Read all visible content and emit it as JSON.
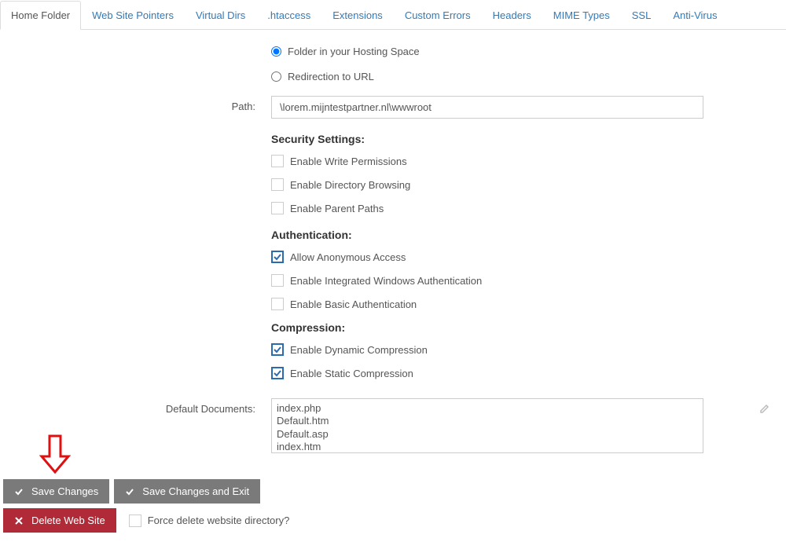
{
  "tabs": [
    {
      "label": "Home Folder",
      "active": true
    },
    {
      "label": "Web Site Pointers",
      "active": false
    },
    {
      "label": "Virtual Dirs",
      "active": false
    },
    {
      "label": ".htaccess",
      "active": false
    },
    {
      "label": "Extensions",
      "active": false
    },
    {
      "label": "Custom Errors",
      "active": false
    },
    {
      "label": "Headers",
      "active": false
    },
    {
      "label": "MIME Types",
      "active": false
    },
    {
      "label": "SSL",
      "active": false
    },
    {
      "label": "Anti-Virus",
      "active": false
    }
  ],
  "contentMode": {
    "folderOption": "Folder in your Hosting Space",
    "redirectOption": "Redirection to URL"
  },
  "pathLabel": "Path:",
  "pathValue": "\\lorem.mijntestpartner.nl\\wwwroot",
  "security": {
    "heading": "Security Settings:",
    "writePerm": "Enable Write Permissions",
    "dirBrowse": "Enable Directory Browsing",
    "parentPaths": "Enable Parent Paths"
  },
  "auth": {
    "heading": "Authentication:",
    "anon": "Allow Anonymous Access",
    "windows": "Enable Integrated Windows Authentication",
    "basic": "Enable Basic Authentication"
  },
  "compression": {
    "heading": "Compression:",
    "dynamic": "Enable Dynamic Compression",
    "static": "Enable Static Compression"
  },
  "defaultDocsLabel": "Default Documents:",
  "defaultDocs": "index.php\nDefault.htm\nDefault.asp\nindex.htm\nindex.html",
  "buttons": {
    "save": "Save Changes",
    "saveExit": "Save Changes and Exit",
    "delete": "Delete Web Site",
    "forceDelete": "Force delete website directory?"
  }
}
